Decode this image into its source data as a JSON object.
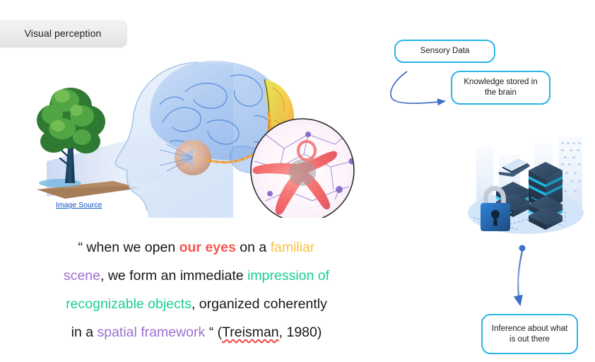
{
  "slide": {
    "title_tab": {
      "label": "Visual perception"
    }
  },
  "left_panel": {
    "figure_name": "visual-perception-brain-illustration",
    "figure_parts": {
      "tree": "tree",
      "light_cone": "light-cone",
      "head": "head-profile",
      "brain": "brain",
      "visual_cortex": "visual-cortex",
      "eye": "eye",
      "optic_nerve": "optic-nerve",
      "neuron_magnifier": "neuron-closeup"
    },
    "image_source_link": "Image Source",
    "quote": {
      "lines": [
        "“ when we open our eyes on a familiar",
        "scene, we form an immediate impression of",
        "recognizable objects, organized coherently",
        "in a spatial framework “ (Treisman, 1980)"
      ],
      "line1": {
        "open_quote": "“ when we open ",
        "highlight_red": "our eyes",
        "mid": " on a ",
        "highlight_yellow": "familiar"
      },
      "line2": {
        "highlight_purple": "scene",
        "mid": ", we form an immediate ",
        "highlight_teal": "impression of"
      },
      "line3": {
        "highlight_teal": "recognizable objects",
        "rest": ", organized coherently"
      },
      "line4": {
        "pre": "in a ",
        "highlight_purple": "spatial framework",
        "close_quote": " “ (",
        "citation_name": "Treisman",
        "citation_rest": ", 1980)"
      },
      "colors": {
        "red": "#f4584f",
        "yellow": "#fbc33c",
        "purple": "#9e6fd0",
        "teal": "#19cf95",
        "body": "#171717",
        "spellcheck_underline": "#e8413a"
      }
    }
  },
  "right_panel": {
    "boxes": [
      {
        "name": "sensory-data",
        "label": "Sensory Data"
      },
      {
        "name": "knowledge-stored",
        "label": "Knowledge stored in the brain"
      },
      {
        "name": "inference",
        "label": "Inference about what is out there"
      }
    ],
    "box_border_color": "#2ab4e8",
    "arrows": [
      {
        "name": "sensory-to-knowledge",
        "color": "#3d6fc4"
      },
      {
        "name": "datacenter-to-inference",
        "color": "#3d6fc4"
      }
    ],
    "datacenter_figure": {
      "figure_name": "datacenter-servers-illustration",
      "parts": {
        "padlock": "padlock",
        "laptop": "laptop",
        "server_tall": "server-rack",
        "server_stack_left": "server-stack",
        "server_stack_right": "server-stack",
        "skyline": "city-skyline",
        "base": "platform-ellipse"
      },
      "accent_color": "#1ec8f0"
    }
  }
}
